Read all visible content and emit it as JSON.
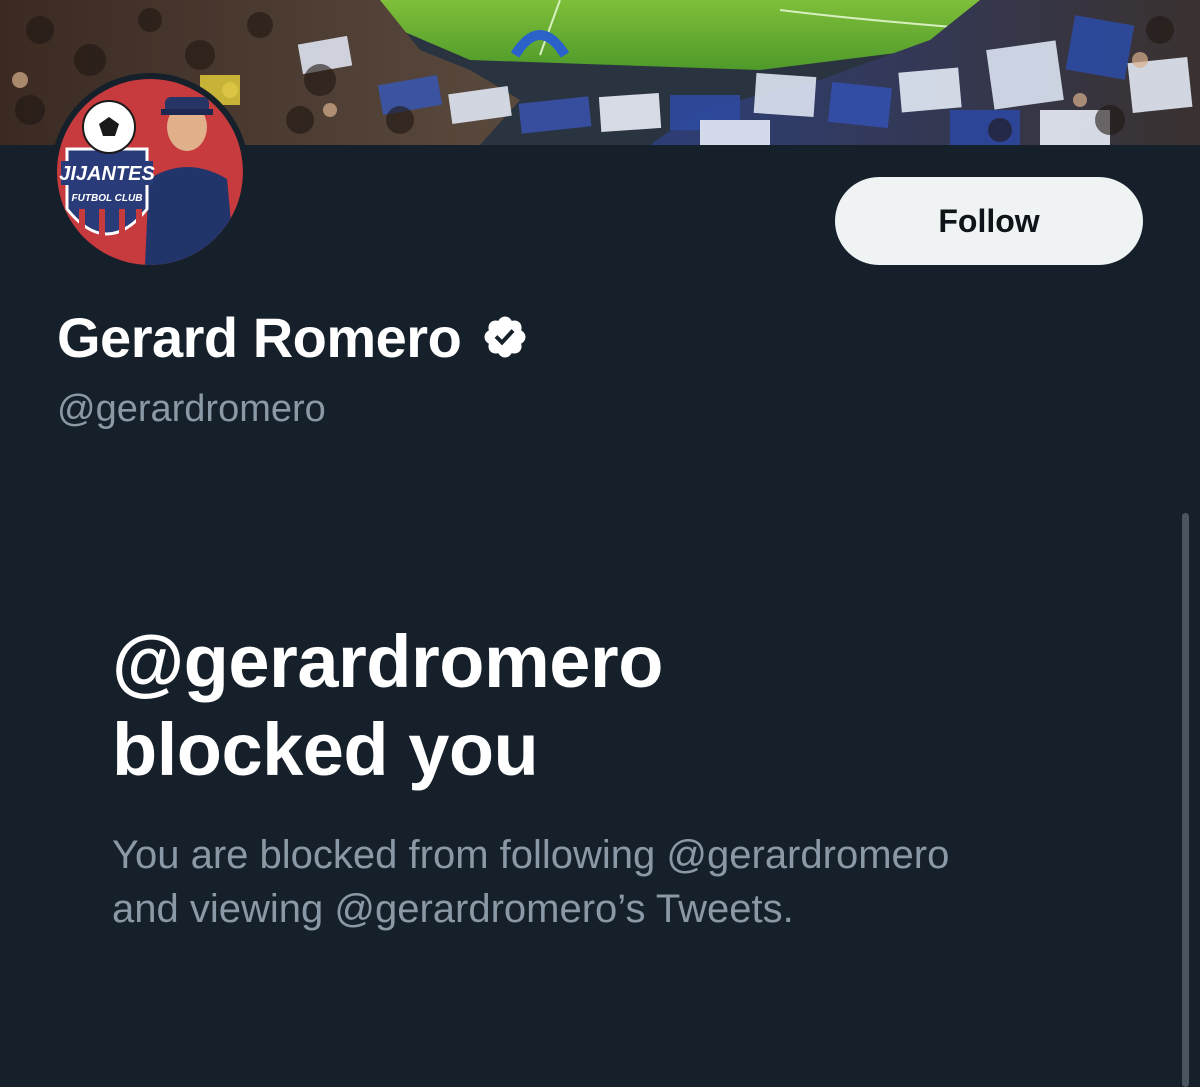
{
  "banner": {
    "description_icon": "stadium-crowd-banner"
  },
  "avatar": {
    "icon": "club-logo-avatar",
    "logo_text_top": "JIJANTES",
    "logo_text_bottom": "FUTBOL CLUB"
  },
  "profile": {
    "display_name": "Gerard Romero",
    "handle": "@gerardromero",
    "follow_label": "Follow",
    "verified_icon": "verified-badge-icon"
  },
  "blocked": {
    "title_line1": "@gerardromero",
    "title_line2": "blocked you",
    "description_line1": "You are blocked from following @gerardromero",
    "description_line2": "and viewing @gerardromero’s Tweets."
  },
  "colors": {
    "background": "#16202b",
    "muted_text": "#8b98a5",
    "button_bg": "#eff3f4",
    "button_text": "#0f1419"
  }
}
